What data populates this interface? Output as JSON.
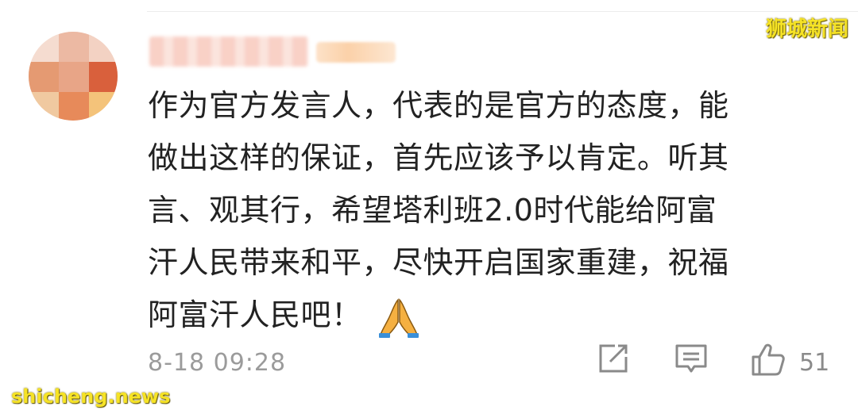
{
  "comment": {
    "username": "",
    "badge": "",
    "lines": [
      "作为官方发言人，代表的是官方的态度，能",
      "做出这样的保证，首先应该予以肯定。听其",
      "言、观其行，希望塔利班2.0时代能给阿富",
      "汗人民带来和平，尽快开启国家重建，祝福",
      "阿富汗人民吧！"
    ],
    "emoji_icon": "folded-hands-icon",
    "timestamp": "8-18 09:28",
    "like_count": "51"
  },
  "actions": {
    "share_icon": "share-icon",
    "reply_icon": "reply-icon",
    "like_icon": "thumbs-up-icon"
  },
  "watermarks": {
    "top_right": "狮城新闻",
    "bottom_left": "shicheng.news"
  },
  "colors": {
    "text": "#222222",
    "meta": "#9b9b9b",
    "watermark": "#f6e326"
  }
}
